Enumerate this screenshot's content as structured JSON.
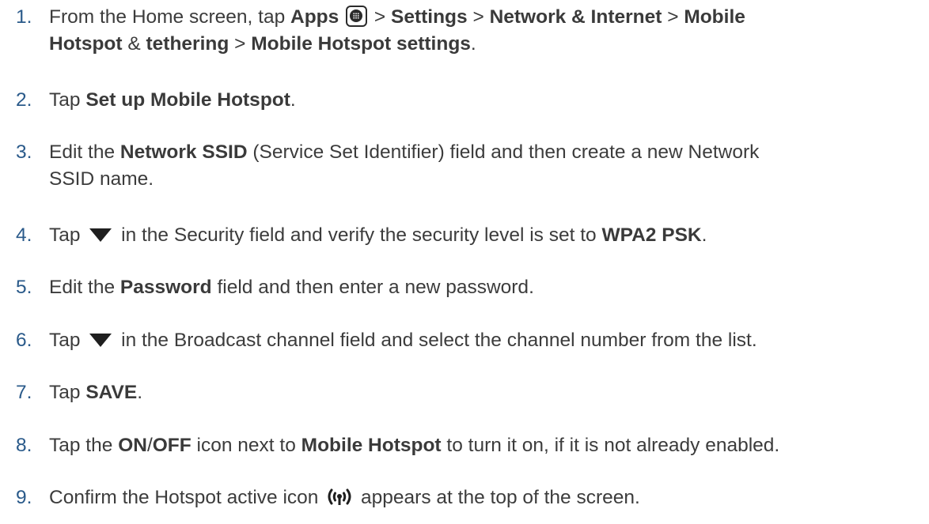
{
  "steps": [
    {
      "num": "1.",
      "line1": [
        {
          "t": "From the Home screen, tap "
        },
        {
          "b": "Apps"
        },
        {
          "t": " "
        },
        {
          "t": " > "
        },
        {
          "b": "Settings"
        },
        {
          "t": " > "
        },
        {
          "b": "Network & Internet"
        },
        {
          "t": " > "
        },
        {
          "b": "Mobile"
        }
      ],
      "line2": [
        {
          "b": "Hotspot"
        },
        {
          "t": " & "
        },
        {
          "b": "tethering"
        },
        {
          "t": " > "
        },
        {
          "b": "Mobile Hotspot settings"
        },
        {
          "t": "."
        }
      ]
    },
    {
      "num": "2.",
      "parts": [
        {
          "t": "Tap "
        },
        {
          "b": "Set up Mobile Hotspot"
        },
        {
          "t": "."
        }
      ]
    },
    {
      "num": "3.",
      "line1": [
        {
          "t": "Edit the "
        },
        {
          "b": "Network SSID"
        },
        {
          "t": " (Service Set Identifier) field and then create a new Network"
        }
      ],
      "line2": [
        {
          "t": "SSID name."
        }
      ]
    },
    {
      "num": "4.",
      "before": "Tap ",
      "after": " in the Security field and verify the security level is set to ",
      "bold": "WPA2 PSK",
      "end": "."
    },
    {
      "num": "5.",
      "parts": [
        {
          "t": "Edit the "
        },
        {
          "b": "Password"
        },
        {
          "t": " field and then enter a new password."
        }
      ]
    },
    {
      "num": "6.",
      "before": "Tap ",
      "after": " in the Broadcast channel field and select the channel number from the list."
    },
    {
      "num": "7.",
      "parts": [
        {
          "t": "Tap "
        },
        {
          "b": "SAVE"
        },
        {
          "t": "."
        }
      ]
    },
    {
      "num": "8.",
      "parts": [
        {
          "t": "Tap the "
        },
        {
          "b": "ON"
        },
        {
          "t": "/"
        },
        {
          "b": "OFF"
        },
        {
          "t": " icon next to "
        },
        {
          "b": "Mobile Hotspot"
        },
        {
          "t": " to turn it on, if it is not already enabled."
        }
      ]
    },
    {
      "num": "9.",
      "before": "Confirm the Hotspot active icon ",
      "after": " appears at the top of the screen."
    }
  ],
  "icons": {
    "apps": "apps-icon",
    "dropdown": "dropdown-triangle-icon",
    "hotspot": "hotspot-active-icon"
  },
  "colors": {
    "number": "#2a5a8a",
    "text": "#3c3c3c"
  }
}
